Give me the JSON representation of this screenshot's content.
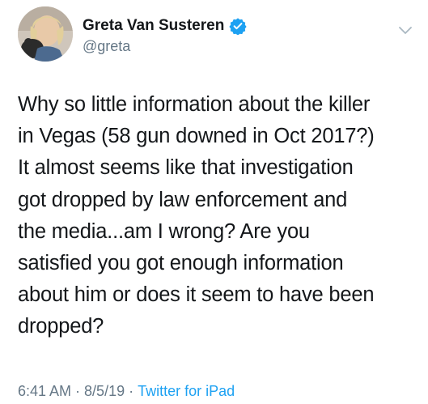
{
  "author": {
    "display_name": "Greta Van Susteren",
    "handle": "@greta",
    "verified": true,
    "avatar_icon": "profile-photo"
  },
  "tweet": {
    "lines": [
      "Why so little information about the killer",
      "in Vegas (58 gun downed in Oct 2017?)",
      "It almost seems like that investigation",
      "got dropped by law enforcement and",
      "the media...am I wrong? Are you",
      "satisfied you got enough information",
      "about him or does it seem to have been",
      "dropped?"
    ]
  },
  "meta": {
    "time": "6:41 AM",
    "separator": "·",
    "date": "8/5/19",
    "source": "Twitter for iPad"
  },
  "colors": {
    "text": "#14171a",
    "secondary": "#657786",
    "accent": "#1da1f2"
  },
  "icons": {
    "verified": "verified-badge-icon",
    "menu": "chevron-down-icon"
  }
}
